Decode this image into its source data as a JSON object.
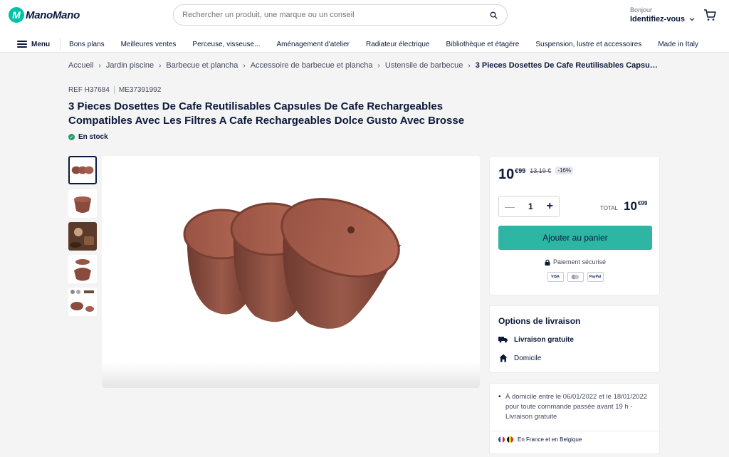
{
  "header": {
    "logo_text": "ManoMano",
    "logo_letter": "M",
    "search_placeholder": "Rechercher un produit, une marque ou un conseil",
    "account_greeting": "Bonjour",
    "account_action": "Identifiez-vous",
    "brand_color": "#00c2a8"
  },
  "nav": {
    "menu_label": "Menu",
    "items": [
      "Bons plans",
      "Meilleures ventes",
      "Perceuse, visseuse...",
      "Aménagement d'atelier",
      "Radiateur électrique",
      "Bibliothèque et étagère",
      "Suspension, lustre et accessoires",
      "Made in Italy"
    ]
  },
  "breadcrumb": {
    "items": [
      "Accueil",
      "Jardin piscine",
      "Barbecue et plancha",
      "Accessoire de barbecue et plancha",
      "Ustensile de barbecue"
    ],
    "current": "3 Pieces Dosettes De Cafe Reutilisables Capsules De Cafe Rechargeables Compatibles Avec Les Filtres A Cafe Rechargeables Dolce Gusto Avec Brosse"
  },
  "product": {
    "ref": "REF H37684",
    "sku": "ME37391992",
    "title": "3 Pieces Dosettes De Cafe Reutilisables Capsules De Cafe Rechargeables Compatibles Avec Les Filtres A Cafe Rechargeables Dolce Gusto Avec Brosse",
    "stock": "En stock"
  },
  "price": {
    "integer": "10",
    "cents": "€99",
    "old_price": "13,19 €",
    "discount": "-16%",
    "quantity": "1",
    "total_label": "TOTAL",
    "total_integer": "10",
    "total_cents": "€99",
    "add_to_cart": "Ajouter au panier",
    "secure_payment": "Paiement sécurisé",
    "payment_methods": [
      "VISA",
      "MC",
      "PayPal"
    ],
    "button_color": "#2eb6a5"
  },
  "delivery": {
    "title": "Options de livraison",
    "options": [
      "Livraison gratuite",
      "Domicile"
    ]
  },
  "info": {
    "text": "À domicile entre le 06/01/2022 et le 18/01/2022 pour toute commande passée avant 19 h",
    "free": "Livraison gratuite",
    "separator": " - ",
    "region": "En France et en Belgique"
  }
}
